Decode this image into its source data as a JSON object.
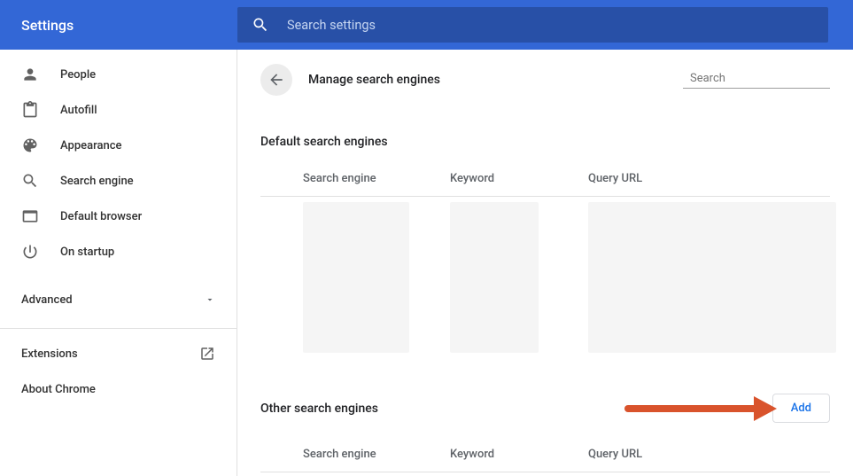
{
  "header": {
    "title": "Settings",
    "search_placeholder": "Search settings"
  },
  "sidebar": {
    "items": [
      {
        "icon": "person",
        "label": "People"
      },
      {
        "icon": "autofill",
        "label": "Autofill"
      },
      {
        "icon": "palette",
        "label": "Appearance"
      },
      {
        "icon": "search",
        "label": "Search engine"
      },
      {
        "icon": "browser",
        "label": "Default browser"
      },
      {
        "icon": "power",
        "label": "On startup"
      }
    ],
    "advanced_label": "Advanced",
    "links": [
      {
        "label": "Extensions",
        "external": true
      },
      {
        "label": "About Chrome",
        "external": false
      }
    ]
  },
  "main": {
    "page_title": "Manage search engines",
    "page_search_placeholder": "Search",
    "default_section": {
      "title": "Default search engines",
      "columns": [
        "Search engine",
        "Keyword",
        "Query URL"
      ]
    },
    "other_section": {
      "title": "Other search engines",
      "columns": [
        "Search engine",
        "Keyword",
        "Query URL"
      ],
      "add_label": "Add"
    }
  }
}
